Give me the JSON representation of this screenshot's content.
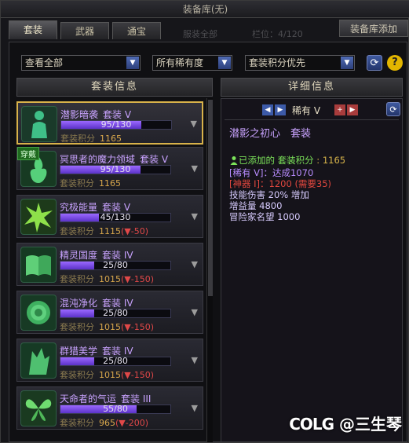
{
  "window": {
    "title": "装备库(无)",
    "add_button": "装备库添加"
  },
  "tabs": [
    {
      "label": "套装",
      "active": true
    },
    {
      "label": "武器",
      "active": false
    },
    {
      "label": "通宝",
      "active": false
    }
  ],
  "ghost_text": {
    "left": "服装全部",
    "right": "栏位：4/120"
  },
  "filters": {
    "view": "查看全部",
    "rarity": "所有稀有度",
    "sort": "套装积分优先"
  },
  "columns": {
    "left": "套装信息",
    "right": "详细信息"
  },
  "sets": [
    {
      "name": "潜影暗袭",
      "tier": "套装 V",
      "progress": "95/130",
      "progress_value": 0.73,
      "score_label": "套装积分",
      "score": "1165",
      "penalty": "",
      "icon": "shadow-figure-icon",
      "selected": true,
      "worn": false
    },
    {
      "name": "冥思者的魔力领域",
      "tier": "套装 V",
      "progress": "95/130",
      "progress_value": 0.73,
      "score_label": "套装积分",
      "score": "1165",
      "penalty": "",
      "icon": "meditation-flame-icon",
      "selected": false,
      "worn": true,
      "worn_label": "穿戴"
    },
    {
      "name": "究极能量",
      "tier": "套装 V",
      "progress": "45/130",
      "progress_value": 0.35,
      "score_label": "套装积分",
      "score": "1115",
      "penalty": "(▼-50)",
      "icon": "energy-burst-icon",
      "selected": false,
      "worn": false
    },
    {
      "name": "精灵国度",
      "tier": "套装 IV",
      "progress": "25/80",
      "progress_value": 0.31,
      "score_label": "套装积分",
      "score": "1015",
      "penalty": "(▼-150)",
      "icon": "open-book-icon",
      "selected": false,
      "worn": false
    },
    {
      "name": "混沌净化",
      "tier": "套装 IV",
      "progress": "25/80",
      "progress_value": 0.31,
      "score_label": "套装积分",
      "score": "1015",
      "penalty": "(▼-150)",
      "icon": "green-rose-icon",
      "selected": false,
      "worn": false
    },
    {
      "name": "群猎美学",
      "tier": "套装 IV",
      "progress": "25/80",
      "progress_value": 0.31,
      "score_label": "套装积分",
      "score": "1015",
      "penalty": "(▼-150)",
      "icon": "wolf-head-icon",
      "selected": false,
      "worn": false
    },
    {
      "name": "天命者的气运",
      "tier": "套装 III",
      "progress": "55/80",
      "progress_value": 0.69,
      "score_label": "套装积分",
      "score": "965",
      "penalty": "(▼-200)",
      "icon": "butterfly-icon",
      "selected": false,
      "worn": false
    }
  ],
  "detail": {
    "rarity": "稀有 V",
    "title": "潜影之初心　套装",
    "added_label": "已添加的",
    "score_label": "套装积分",
    "score": "1165",
    "rarity_reached": "[稀有 V]：达成1070",
    "artifact_line": "[神器 I]：1200 (需要35)",
    "stats": [
      {
        "name": "技能伤害",
        "value": "20% 增加"
      },
      {
        "name": "增益量",
        "value": "4800"
      },
      {
        "name": "冒险家名望",
        "value": "1000"
      }
    ]
  },
  "watermark": {
    "brand": "COLG",
    "author": "@三生琴"
  },
  "colors": {
    "accent_purple": "#9b69ff",
    "score_gold": "#d8a74c",
    "penalty_red": "#e04848",
    "selected_border": "#d8b24a",
    "green": "#7ce35a"
  }
}
